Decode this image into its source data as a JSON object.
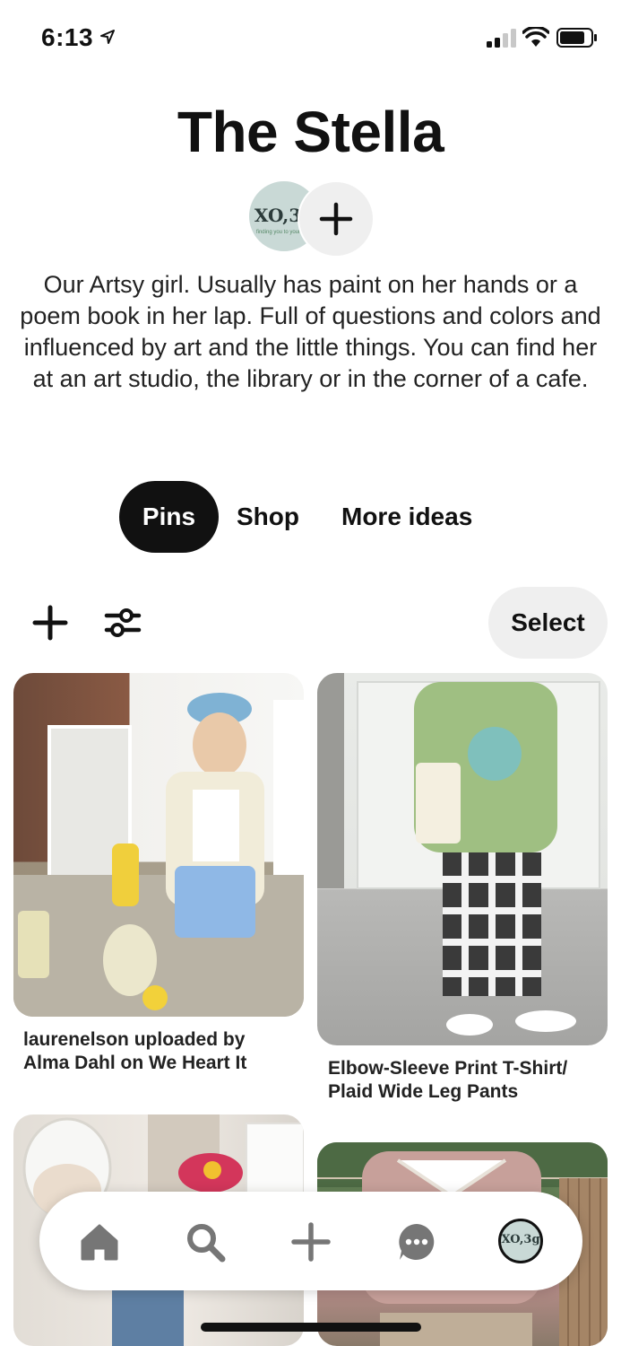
{
  "status_bar": {
    "time": "6:13"
  },
  "board": {
    "title": "The Stella",
    "avatar_text": "XO,3g",
    "avatar_sub": "finding you to your best",
    "description": "Our Artsy girl. Usually has paint on her hands or a poem book in her lap. Full of questions and colors and influenced by art and the little things. You can find her at an art studio, the library or in the corner of a cafe."
  },
  "tabs": [
    {
      "label": "Pins",
      "active": true
    },
    {
      "label": "Shop",
      "active": false
    },
    {
      "label": "More ideas",
      "active": false
    }
  ],
  "toolbar": {
    "select_label": "Select"
  },
  "pins": [
    {
      "caption": "laurenelson uploaded by Alma Dahl on We Heart It"
    },
    {
      "caption": "Elbow-Sleeve Print T-Shirt/ Plaid Wide Leg Pants"
    },
    {
      "caption": ""
    },
    {
      "caption": ""
    }
  ],
  "bottom_nav": {
    "items": [
      "home-icon",
      "search-icon",
      "plus-icon",
      "chat-icon",
      "profile-avatar"
    ],
    "profile_text": "XO,3g"
  }
}
